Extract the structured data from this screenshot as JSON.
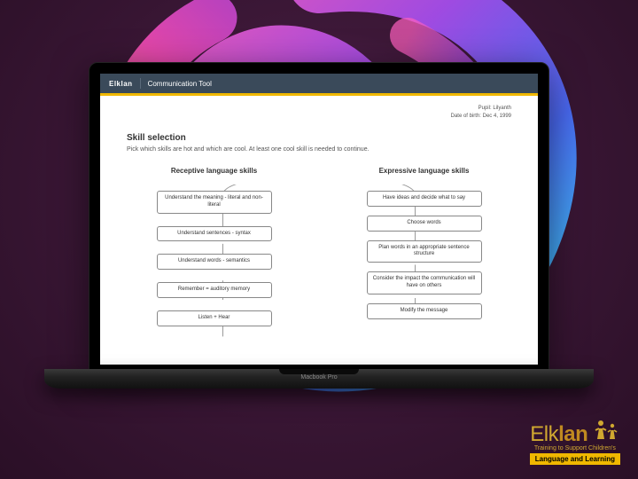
{
  "header": {
    "logo": "Elklan",
    "tool": "Communication Tool"
  },
  "meta": {
    "pupil_label": "Pupil:",
    "pupil_name": "Lilyanth",
    "dob_label": "Date of birth:",
    "dob_value": "Dec 4, 1999"
  },
  "page": {
    "title": "Skill selection",
    "subtitle": "Pick which skills are hot and which are cool. At least one cool skill is needed to continue."
  },
  "columns": {
    "receptive": {
      "title": "Receptive language skills",
      "items": [
        "Understand the meaning - literal and non-literal",
        "Understand sentences - syntax",
        "Understand words - semantics",
        "Remember = auditory memory",
        "Listen + Hear"
      ]
    },
    "expressive": {
      "title": "Expressive language skills",
      "items": [
        "Have ideas and decide what to say",
        "Choose words",
        "Plan words in an appropriate sentence structure",
        "Consider the impact the communication will have on others",
        "Modify the message"
      ]
    }
  },
  "laptop": {
    "label": "Macbook Pro"
  },
  "brand": {
    "name_pre": "Elk",
    "name_bold": "lan",
    "tagline": "Training to Support Children's",
    "bar": "Language and Learning"
  }
}
